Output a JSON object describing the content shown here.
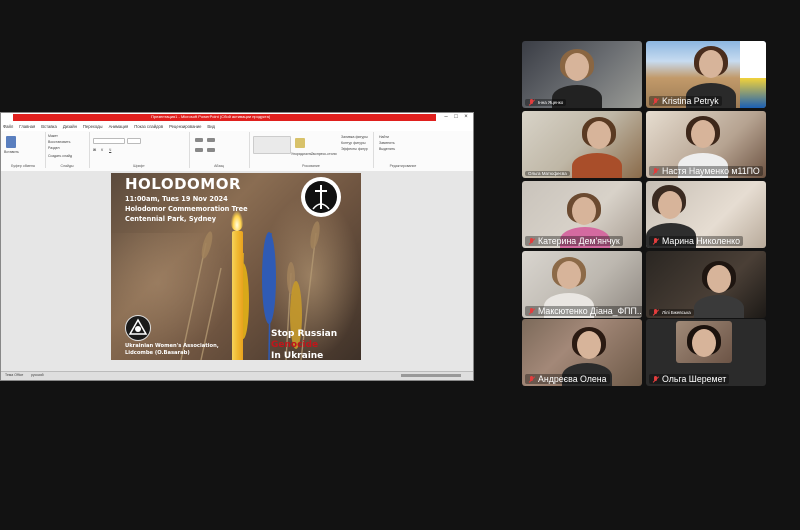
{
  "shared_window": {
    "title_text": "Презентация1 - Microsoft PowerPoint (Сбой активации продукта)",
    "window_buttons": [
      "–",
      "□",
      "×"
    ],
    "menu_tabs": [
      "Файл",
      "Главная",
      "Вставка",
      "Дизайн",
      "Переходы",
      "Анимация",
      "Показ слайдов",
      "Рецензирование",
      "Вид"
    ],
    "ribbon_groups": [
      "Буфер обмена",
      "Слайды",
      "Шрифт",
      "Абзац",
      "Рисование",
      "Редактирование"
    ],
    "ribbon_items": [
      "Вставить",
      "Создать слайд",
      "Макет",
      "Восстановить",
      "Раздел",
      "Упорядочить",
      "Экспресс-стили",
      "Заливка фигуры",
      "Контур фигуры",
      "Эффекты фигур",
      "Найти",
      "Заменить",
      "Выделить"
    ],
    "status_text": "Тема Office",
    "status_lang": "русский"
  },
  "slide": {
    "title": "HOLODOMOR",
    "line1": "11:00am, Tues 19 Nov 2024",
    "line2": "Holodomor Commemoration Tree",
    "line3": "Centennial Park, Sydney",
    "org_line1": "Ukrainian Women's Association,",
    "org_line2": "Lidcombe (O.Basarab)",
    "stop_line1": "Stop Russian",
    "stop_line2": "Genocide",
    "stop_line3": "In Ukraine",
    "colors": {
      "accent_red": "#c0161b",
      "wheat_blue": "#2f5bb5",
      "wheat_yellow": "#e9b81f"
    }
  },
  "participants": [
    {
      "name": "Інна Яценко",
      "muted": true
    },
    {
      "name": "Kristina Petryk",
      "muted": true
    },
    {
      "name": "Ольга Матюфеєва",
      "muted": false
    },
    {
      "name": "Настя Науменко м11ПО",
      "muted": true
    },
    {
      "name": "Катерина Дем'янчук",
      "muted": true
    },
    {
      "name": "Марина Николенко",
      "muted": true
    },
    {
      "name": "Максютенко Діана_ФПП...",
      "muted": true
    },
    {
      "name": "Лілі Бжевська",
      "muted": true
    },
    {
      "name": "Андреєва Олена",
      "muted": true
    },
    {
      "name": "Ольга Шеремет",
      "muted": true
    }
  ],
  "icons": {
    "mic_muted": "mic-off-icon"
  }
}
